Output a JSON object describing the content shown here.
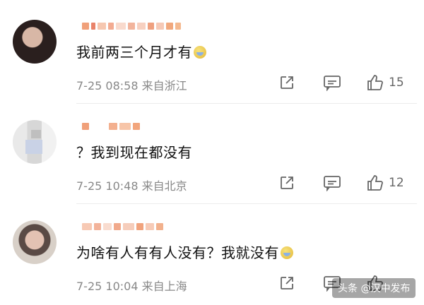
{
  "comments": [
    {
      "text": "我前两三个月才有",
      "has_emoji": true,
      "date": "7-25 08:58",
      "location": "来自浙江",
      "likes": "15",
      "name_blocks": [
        {
          "w": 10,
          "c": "#f0a07a"
        },
        {
          "w": 6,
          "c": "#e9836a"
        },
        {
          "w": 12,
          "c": "#f6c7b0"
        },
        {
          "w": 8,
          "c": "#f3ab91"
        },
        {
          "w": 14,
          "c": "#f9dacd"
        },
        {
          "w": 10,
          "c": "#f2b49c"
        },
        {
          "w": 12,
          "c": "#f7d0c0"
        },
        {
          "w": 9,
          "c": "#efa07f"
        },
        {
          "w": 11,
          "c": "#f6c9b6"
        },
        {
          "w": 10,
          "c": "#f1a87d"
        },
        {
          "w": 8,
          "c": "#f4b98f"
        }
      ]
    },
    {
      "text": "？我到现在都没有",
      "has_emoji": false,
      "date": "7-25 10:48",
      "location": "来自北京",
      "likes": "12",
      "name_blocks": [
        {
          "w": 10,
          "c": "#f0a07a"
        },
        {
          "w": 22,
          "c": "#ffffff"
        },
        {
          "w": 12,
          "c": "#f3b08f"
        },
        {
          "w": 16,
          "c": "#f7c5a8"
        },
        {
          "w": 10,
          "c": "#f2a57c"
        }
      ]
    },
    {
      "text": "为啥有人有有人没有？我就没有",
      "has_emoji": true,
      "date": "7-25 10:04",
      "location": "来自上海",
      "likes": "",
      "name_blocks": [
        {
          "w": 14,
          "c": "#f7c9b4"
        },
        {
          "w": 10,
          "c": "#f3b39a"
        },
        {
          "w": 12,
          "c": "#f9dccf"
        },
        {
          "w": 10,
          "c": "#f1a98b"
        },
        {
          "w": 16,
          "c": "#f6cdbb"
        },
        {
          "w": 10,
          "c": "#f1a37d"
        },
        {
          "w": 12,
          "c": "#f7cbb7"
        },
        {
          "w": 10,
          "c": "#f2b18d"
        }
      ]
    }
  ],
  "icons": {
    "share": "share-icon",
    "reply": "comment-icon",
    "like": "thumbs-up-icon"
  },
  "watermark": "头条 @汉中发布"
}
